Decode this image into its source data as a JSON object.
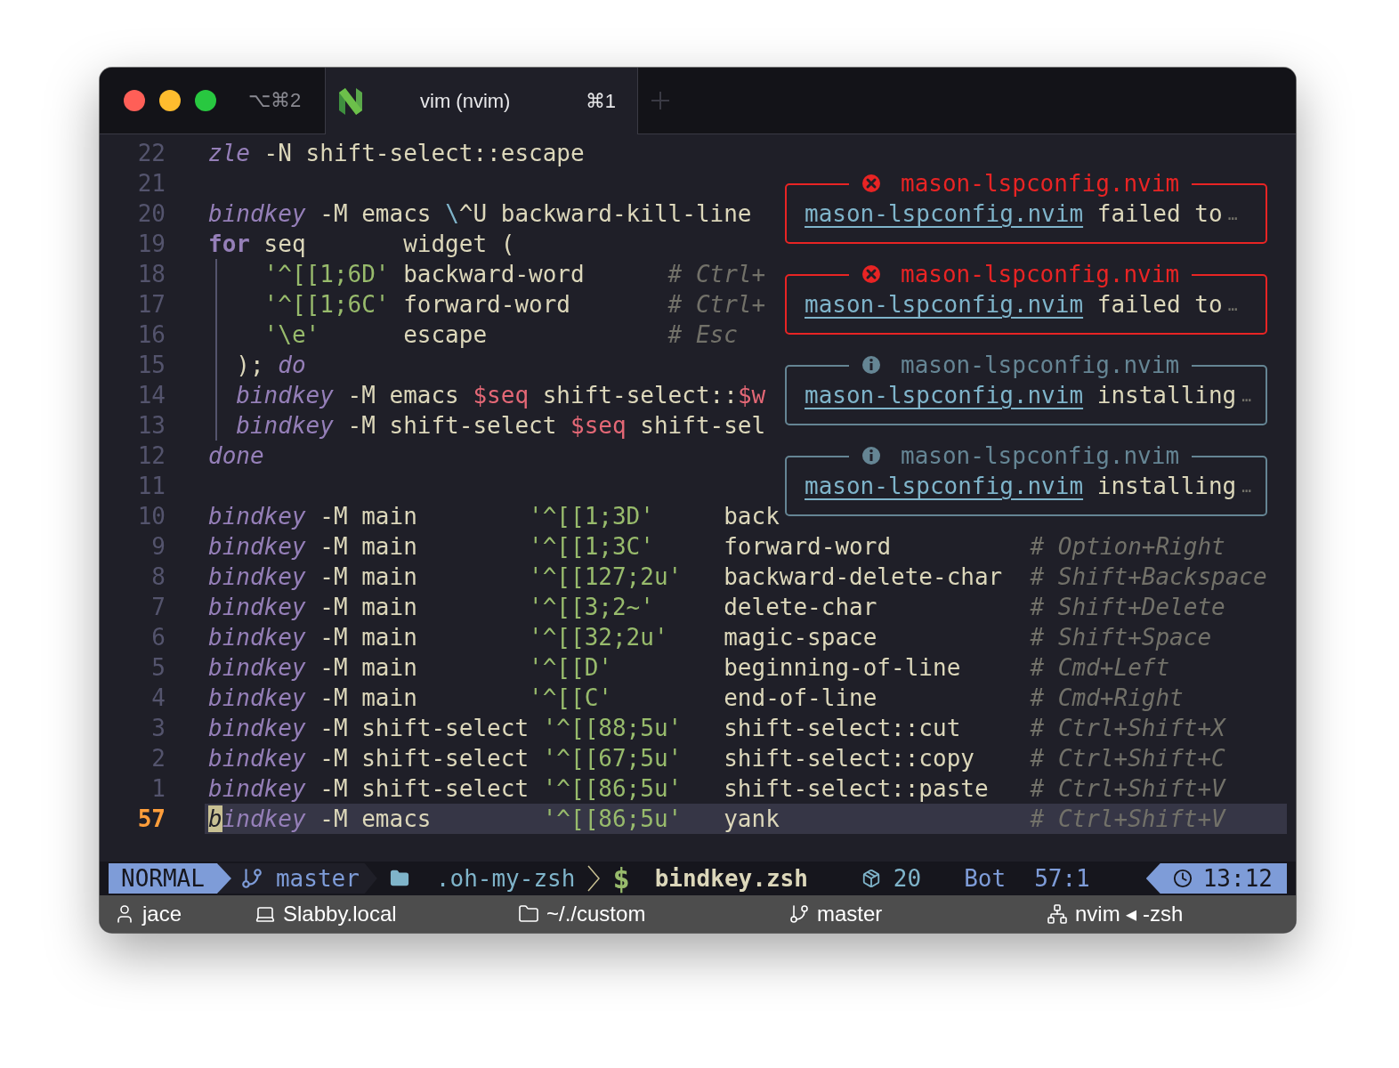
{
  "window": {
    "tabs": [
      {
        "label": "⌥⌘2",
        "selected": false
      },
      {
        "label": "vim (nvim)",
        "shortcut": "⌘1",
        "selected": true
      }
    ]
  },
  "editor": {
    "lines": [
      {
        "number": "22",
        "current": false,
        "indent_guide": false,
        "tokens": [
          {
            "kind": "keyword",
            "text": "zle"
          },
          {
            "kind": "plain",
            "text": " -N shift-select::escape"
          }
        ]
      },
      {
        "number": "21",
        "current": false,
        "indent_guide": false
      },
      {
        "number": "20",
        "current": false,
        "indent_guide": false,
        "tokens": [
          {
            "kind": "keyword",
            "text": "bindkey"
          },
          {
            "kind": "plain",
            "text": " -M emacs "
          },
          {
            "kind": "escape",
            "text": "\\"
          },
          {
            "kind": "plain",
            "text": "^U backward-kill-line"
          }
        ]
      },
      {
        "number": "19",
        "current": false,
        "indent_guide": false,
        "tokens": [
          {
            "kind": "control",
            "text": "for"
          },
          {
            "kind": "plain",
            "text": " seq       widget ("
          }
        ]
      },
      {
        "number": "18",
        "current": false,
        "indent_guide": true,
        "tokens": [
          {
            "kind": "string",
            "text": "    '^[[1;6D'"
          },
          {
            "kind": "plain",
            "text": " backward-word      "
          },
          {
            "kind": "comment",
            "text": "# Ctrl+"
          }
        ]
      },
      {
        "number": "17",
        "current": false,
        "indent_guide": true,
        "tokens": [
          {
            "kind": "string",
            "text": "    '^[[1;6C'"
          },
          {
            "kind": "plain",
            "text": " forward-word       "
          },
          {
            "kind": "comment",
            "text": "# Ctrl+"
          }
        ]
      },
      {
        "number": "16",
        "current": false,
        "indent_guide": true,
        "tokens": [
          {
            "kind": "string",
            "text": "    '\\e'"
          },
          {
            "kind": "plain",
            "text": "      escape             "
          },
          {
            "kind": "comment",
            "text": "# Esc"
          }
        ]
      },
      {
        "number": "15",
        "current": false,
        "indent_guide": true,
        "tokens": [
          {
            "kind": "plain",
            "text": "  ); "
          },
          {
            "kind": "keyword",
            "text": "do"
          }
        ]
      },
      {
        "number": "14",
        "current": false,
        "indent_guide": true,
        "tokens": [
          {
            "kind": "keyword",
            "text": "  bindkey"
          },
          {
            "kind": "plain",
            "text": " -M emacs "
          },
          {
            "kind": "variable",
            "text": "$seq"
          },
          {
            "kind": "plain",
            "text": " shift-select::"
          },
          {
            "kind": "variable",
            "text": "$w"
          }
        ]
      },
      {
        "number": "13",
        "current": false,
        "indent_guide": true,
        "tokens": [
          {
            "kind": "keyword",
            "text": "  bindkey"
          },
          {
            "kind": "plain",
            "text": " -M shift-select "
          },
          {
            "kind": "variable",
            "text": "$seq"
          },
          {
            "kind": "plain",
            "text": " shift-sel"
          }
        ]
      },
      {
        "number": "12",
        "current": false,
        "indent_guide": false,
        "tokens": [
          {
            "kind": "keyword",
            "text": "done"
          }
        ]
      },
      {
        "number": "11",
        "current": false,
        "indent_guide": false
      },
      {
        "number": "10",
        "current": false,
        "indent_guide": false,
        "tokens": [
          {
            "kind": "keyword",
            "text": "bindkey"
          },
          {
            "kind": "plain",
            "text": " -M main        "
          },
          {
            "kind": "string",
            "text": "'^[[1;3D'"
          },
          {
            "kind": "plain",
            "text": "     back"
          }
        ]
      },
      {
        "number": "9",
        "current": false,
        "indent_guide": false,
        "tokens": [
          {
            "kind": "keyword",
            "text": "bindkey"
          },
          {
            "kind": "plain",
            "text": " -M main        "
          },
          {
            "kind": "string",
            "text": "'^[[1;3C'"
          },
          {
            "kind": "plain",
            "text": "     forward-word          "
          },
          {
            "kind": "comment",
            "text": "# Option+Right"
          }
        ]
      },
      {
        "number": "8",
        "current": false,
        "indent_guide": false,
        "tokens": [
          {
            "kind": "keyword",
            "text": "bindkey"
          },
          {
            "kind": "plain",
            "text": " -M main        "
          },
          {
            "kind": "string",
            "text": "'^[[127;2u'"
          },
          {
            "kind": "plain",
            "text": "   backward-delete-char  "
          },
          {
            "kind": "comment",
            "text": "# Shift+Backspace"
          }
        ]
      },
      {
        "number": "7",
        "current": false,
        "indent_guide": false,
        "tokens": [
          {
            "kind": "keyword",
            "text": "bindkey"
          },
          {
            "kind": "plain",
            "text": " -M main        "
          },
          {
            "kind": "string",
            "text": "'^[[3;2~'"
          },
          {
            "kind": "plain",
            "text": "     delete-char           "
          },
          {
            "kind": "comment",
            "text": "# Shift+Delete"
          }
        ]
      },
      {
        "number": "6",
        "current": false,
        "indent_guide": false,
        "tokens": [
          {
            "kind": "keyword",
            "text": "bindkey"
          },
          {
            "kind": "plain",
            "text": " -M main        "
          },
          {
            "kind": "string",
            "text": "'^[[32;2u'"
          },
          {
            "kind": "plain",
            "text": "    magic-space           "
          },
          {
            "kind": "comment",
            "text": "# Shift+Space"
          }
        ]
      },
      {
        "number": "5",
        "current": false,
        "indent_guide": false,
        "tokens": [
          {
            "kind": "keyword",
            "text": "bindkey"
          },
          {
            "kind": "plain",
            "text": " -M main        "
          },
          {
            "kind": "string",
            "text": "'^[[D'"
          },
          {
            "kind": "plain",
            "text": "        beginning-of-line     "
          },
          {
            "kind": "comment",
            "text": "# Cmd+Left"
          }
        ]
      },
      {
        "number": "4",
        "current": false,
        "indent_guide": false,
        "tokens": [
          {
            "kind": "keyword",
            "text": "bindkey"
          },
          {
            "kind": "plain",
            "text": " -M main        "
          },
          {
            "kind": "string",
            "text": "'^[[C'"
          },
          {
            "kind": "plain",
            "text": "        end-of-line           "
          },
          {
            "kind": "comment",
            "text": "# Cmd+Right"
          }
        ]
      },
      {
        "number": "3",
        "current": false,
        "indent_guide": false,
        "tokens": [
          {
            "kind": "keyword",
            "text": "bindkey"
          },
          {
            "kind": "plain",
            "text": " -M shift-select "
          },
          {
            "kind": "string",
            "text": "'^[[88;5u'"
          },
          {
            "kind": "plain",
            "text": "   shift-select::cut     "
          },
          {
            "kind": "comment",
            "text": "# Ctrl+Shift+X"
          }
        ]
      },
      {
        "number": "2",
        "current": false,
        "indent_guide": false,
        "tokens": [
          {
            "kind": "keyword",
            "text": "bindkey"
          },
          {
            "kind": "plain",
            "text": " -M shift-select "
          },
          {
            "kind": "string",
            "text": "'^[[67;5u'"
          },
          {
            "kind": "plain",
            "text": "   shift-select::copy    "
          },
          {
            "kind": "comment",
            "text": "# Ctrl+Shift+C"
          }
        ]
      },
      {
        "number": "1",
        "current": false,
        "indent_guide": false,
        "tokens": [
          {
            "kind": "keyword",
            "text": "bindkey"
          },
          {
            "kind": "plain",
            "text": " -M shift-select "
          },
          {
            "kind": "string",
            "text": "'^[[86;5u'"
          },
          {
            "kind": "plain",
            "text": "   shift-select::paste   "
          },
          {
            "kind": "comment",
            "text": "# Ctrl+Shift+V"
          }
        ]
      },
      {
        "number": "57",
        "current": true,
        "indent_guide": false,
        "tokens": [
          {
            "kind": "keyword",
            "text": "b",
            "cursor": true
          },
          {
            "kind": "keyword",
            "text": "indkey"
          },
          {
            "kind": "plain",
            "text": " -M emacs        "
          },
          {
            "kind": "string",
            "text": "'^[[86;5u'"
          },
          {
            "kind": "plain",
            "text": "   yank                  "
          },
          {
            "kind": "comment",
            "text": "# Ctrl+Shift+V"
          }
        ]
      }
    ],
    "notifications": [
      {
        "kind": "error",
        "title": "mason-lspconfig.nvim",
        "link": "mason-lspconfig.nvim",
        "message": "failed to",
        "ellipsis": "…"
      },
      {
        "kind": "error",
        "title": "mason-lspconfig.nvim",
        "link": "mason-lspconfig.nvim",
        "message": "failed to",
        "ellipsis": "…"
      },
      {
        "kind": "info",
        "title": "mason-lspconfig.nvim",
        "link": "mason-lspconfig.nvim",
        "message": "installing",
        "ellipsis": "…"
      },
      {
        "kind": "info",
        "title": "mason-lspconfig.nvim",
        "link": "mason-lspconfig.nvim",
        "message": "installing",
        "ellipsis": "…"
      }
    ]
  },
  "status_line": {
    "mode": "NORMAL",
    "branch": "master",
    "directory": ".oh-my-zsh",
    "prompt": "$",
    "file": "bindkey.zsh",
    "count": "20",
    "position": "Bot",
    "cursor": "57:1",
    "time": "13:12"
  },
  "tmux_bar": [
    {
      "kind": "user",
      "label": "jace"
    },
    {
      "kind": "host",
      "label": "Slabby.local"
    },
    {
      "kind": "directory",
      "label": "~/./custom"
    },
    {
      "kind": "branch",
      "label": "master"
    },
    {
      "kind": "process",
      "label": "nvim ◂ -zsh"
    }
  ]
}
